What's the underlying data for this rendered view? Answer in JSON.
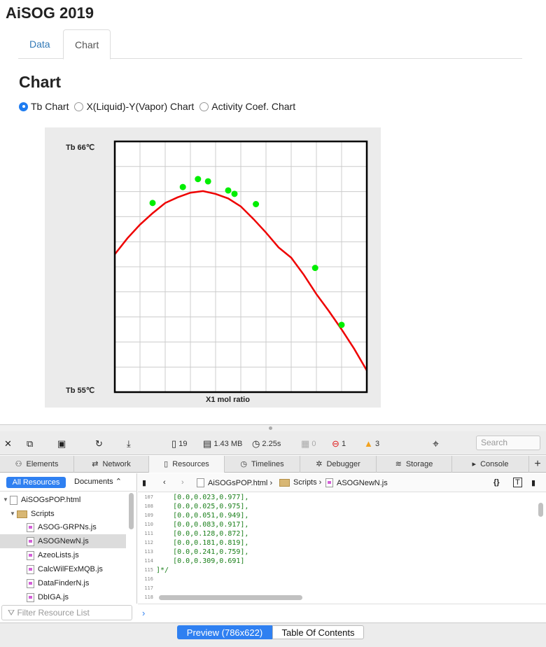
{
  "page": {
    "title": "AiSOG 2019",
    "section_heading": "Chart"
  },
  "tabs": [
    {
      "label": "Data",
      "active": false
    },
    {
      "label": "Chart",
      "active": true
    }
  ],
  "radio_options": [
    {
      "label": "Tb Chart",
      "checked": true
    },
    {
      "label": "X(Liquid)-Y(Vapor) Chart",
      "checked": false
    },
    {
      "label": "Activity Coef. Chart",
      "checked": false
    }
  ],
  "chart_data": {
    "type": "scatter",
    "x_axis_label": "X1 mol ratio",
    "y_top_label": "Tb 66℃",
    "y_bottom_label": "Tb 55℃",
    "xlim": [
      0,
      1
    ],
    "ylim": [
      55,
      66
    ],
    "grid": true,
    "colors": {
      "points": "#00ee00",
      "curve": "#ee0000",
      "background": "#ebebeb"
    },
    "points": [
      {
        "x": 0.15,
        "y": 63.3
      },
      {
        "x": 0.27,
        "y": 64.0
      },
      {
        "x": 0.33,
        "y": 64.35
      },
      {
        "x": 0.37,
        "y": 64.25
      },
      {
        "x": 0.45,
        "y": 63.85
      },
      {
        "x": 0.475,
        "y": 63.7
      },
      {
        "x": 0.56,
        "y": 63.25
      },
      {
        "x": 0.795,
        "y": 60.45
      },
      {
        "x": 0.9,
        "y": 57.95
      }
    ],
    "curve": [
      {
        "x": 0.0,
        "y": 61.05
      },
      {
        "x": 0.05,
        "y": 61.75
      },
      {
        "x": 0.1,
        "y": 62.35
      },
      {
        "x": 0.15,
        "y": 62.85
      },
      {
        "x": 0.2,
        "y": 63.3
      },
      {
        "x": 0.25,
        "y": 63.55
      },
      {
        "x": 0.3,
        "y": 63.75
      },
      {
        "x": 0.35,
        "y": 63.82
      },
      {
        "x": 0.4,
        "y": 63.7
      },
      {
        "x": 0.45,
        "y": 63.5
      },
      {
        "x": 0.5,
        "y": 63.15
      },
      {
        "x": 0.55,
        "y": 62.6
      },
      {
        "x": 0.6,
        "y": 62.0
      },
      {
        "x": 0.65,
        "y": 61.35
      },
      {
        "x": 0.7,
        "y": 60.9
      },
      {
        "x": 0.75,
        "y": 60.15
      },
      {
        "x": 0.8,
        "y": 59.3
      },
      {
        "x": 0.85,
        "y": 58.55
      },
      {
        "x": 0.9,
        "y": 57.75
      },
      {
        "x": 0.95,
        "y": 56.9
      },
      {
        "x": 1.0,
        "y": 55.95
      }
    ]
  },
  "devtools": {
    "toolbar": {
      "resources": "19",
      "size": "1.43 MB",
      "time": "2.25s",
      "logs": "0",
      "errors": "1",
      "warnings": "3",
      "search_placeholder": "Search"
    },
    "tabs": [
      "Elements",
      "Network",
      "Resources",
      "Timelines",
      "Debugger",
      "Storage",
      "Console"
    ],
    "active_tab": "Resources",
    "sidebar": {
      "all_resources": "All Resources",
      "documents": "Documents ⌃",
      "tree": [
        {
          "label": "AiSOGsPOP.html",
          "level": 0,
          "type": "html"
        },
        {
          "label": "Scripts",
          "level": 1,
          "type": "folder"
        },
        {
          "label": "ASOG-GRPNs.js",
          "level": 2,
          "type": "js"
        },
        {
          "label": "ASOGNewN.js",
          "level": 2,
          "type": "js",
          "selected": true
        },
        {
          "label": "AzeoLists.js",
          "level": 2,
          "type": "js"
        },
        {
          "label": "CalcWilFExMQB.js",
          "level": 2,
          "type": "js"
        },
        {
          "label": "DataFinderN.js",
          "level": 2,
          "type": "js"
        },
        {
          "label": "DbIGA.js",
          "level": 2,
          "type": "js"
        }
      ],
      "filter_placeholder": "Filter Resource List"
    },
    "path": {
      "file": "AiSOGsPOP.html",
      "folder": "Scripts",
      "script": "ASOGNewN.js"
    },
    "code": [
      {
        "n": "107",
        "t": "    [0.0,0.023,0.977],"
      },
      {
        "n": "108",
        "t": "    [0.0,0.025,0.975],"
      },
      {
        "n": "109",
        "t": "    [0.0,0.051,0.949],"
      },
      {
        "n": "110",
        "t": "    [0.0,0.083,0.917],"
      },
      {
        "n": "111",
        "t": "    [0.0,0.128,0.872],"
      },
      {
        "n": "112",
        "t": "    [0.0,0.181,0.819],"
      },
      {
        "n": "113",
        "t": "    [0.0,0.241,0.759],"
      },
      {
        "n": "114",
        "t": "    [0.0,0.309,0.691]"
      },
      {
        "n": "115",
        "t": "]*/"
      },
      {
        "n": "116",
        "t": ""
      },
      {
        "n": "117",
        "t": ""
      },
      {
        "n": "118",
        "t": ""
      }
    ],
    "preview_label": "Preview (786x622)",
    "toc_label": "Table Of Contents"
  }
}
